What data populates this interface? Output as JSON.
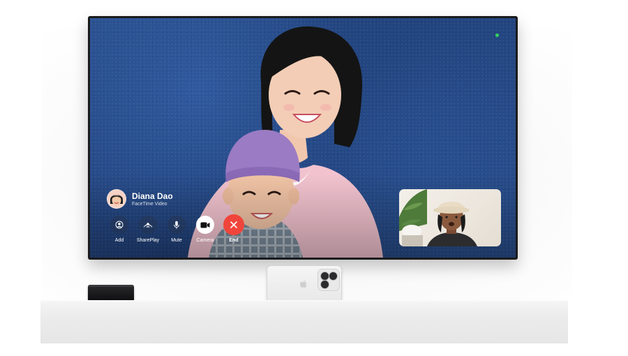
{
  "call": {
    "caller_name": "Diana Dao",
    "caller_subtitle": "FaceTime Video"
  },
  "controls": [
    {
      "id": "add",
      "label": "Add",
      "icon": "person-add-icon"
    },
    {
      "id": "shareplay",
      "label": "SharePlay",
      "icon": "shareplay-icon"
    },
    {
      "id": "mute",
      "label": "Mute",
      "icon": "microphone-icon"
    },
    {
      "id": "camera",
      "label": "Camera",
      "icon": "video-camera-icon"
    },
    {
      "id": "end",
      "label": "End",
      "icon": "close-icon"
    }
  ],
  "colors": {
    "end_button": "#f0453b",
    "camera_indicator": "#2fd35b",
    "wall_blue": "#2a4f8f"
  }
}
